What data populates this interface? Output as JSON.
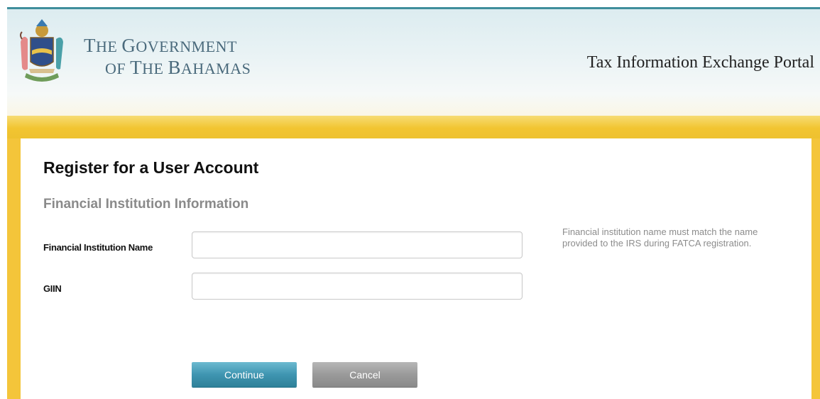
{
  "header": {
    "gov_line1_cap1": "T",
    "gov_line1_rest1": "HE ",
    "gov_line1_cap2": "G",
    "gov_line1_rest2": "OVERNMENT",
    "gov_line2_cap1": "",
    "gov_line2_rest1": "OF ",
    "gov_line2_cap2": "T",
    "gov_line2_rest2": "HE ",
    "gov_line2_cap3": "B",
    "gov_line2_rest3": "AHAMAS",
    "portal_title": "Tax Information Exchange Portal",
    "crest_icon": "coat-of-arms-icon"
  },
  "form": {
    "page_title": "Register for a User Account",
    "section_title": "Financial Institution Information",
    "fields": [
      {
        "label": "Financial Institution Name",
        "value": "",
        "placeholder": ""
      },
      {
        "label": "GIIN",
        "value": "",
        "placeholder": ""
      }
    ],
    "help_text": "Financial institution name must match the name provided to the IRS during FATCA registration.",
    "continue_label": "Continue",
    "cancel_label": "Cancel"
  },
  "colors": {
    "accent_teal": "#3f95b1",
    "gold": "#f2c531",
    "header_text": "#4a6a7c"
  }
}
